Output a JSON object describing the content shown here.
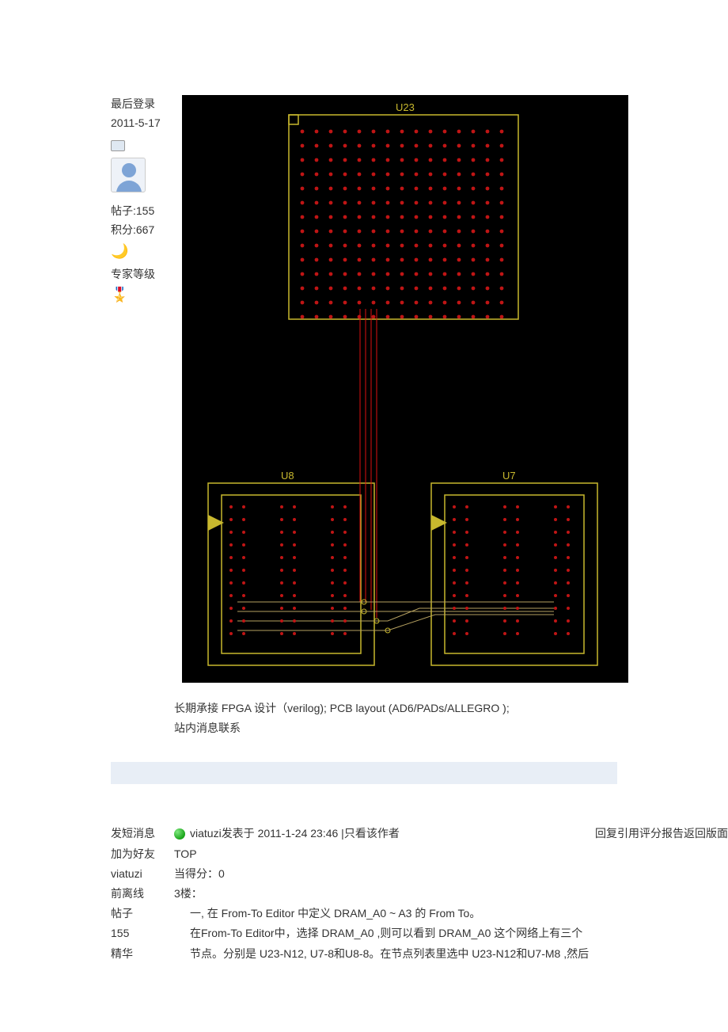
{
  "sidebar": {
    "last_login_label": "最后登录",
    "last_login_value": "2011-5-17",
    "posts_label": "帖子",
    "posts_value": "155",
    "points_label": "积分",
    "points_value": "667",
    "expert_level_label": "专家等级",
    "moon_icon": "🌙",
    "badge_icon": "🎖️"
  },
  "pcb": {
    "u23": "U23",
    "u8": "U8",
    "u7": "U7"
  },
  "footnote": {
    "line1": "长期承接 FPGA 设计（verilog); PCB layout (AD6/PADs/ALLEGRO );",
    "line2": "站内消息联系"
  },
  "post2": {
    "left_lines": {
      "l1": "发短消息",
      "l2": "加为好友",
      "l3": "viatuzi",
      "l4": "前离线",
      "l5": "帖子",
      "l6": "155",
      "l7": "精华"
    },
    "meta": {
      "author": "viatuzi",
      "posted_label": "发表于",
      "time": "2011-1-24 23:46",
      "only_author": "只看该作者",
      "actions": "回复引用评分报告返回版面"
    },
    "top": "TOP",
    "score_label": "当得分：",
    "score_value": "0",
    "floor": "3楼：",
    "body_line1": "一, 在 From-To Editor 中定义 DRAM_A0 ~ A3 的 From To。",
    "body_line2": "在From-To Editor中，选择 DRAM_A0 ,则可以看到 DRAM_A0 这个网络上有三个",
    "body_line3": "节点。分别是 U23-N12, U7-8和U8-8。在节点列表里选中 U23-N12和U7-M8 ,然后"
  }
}
